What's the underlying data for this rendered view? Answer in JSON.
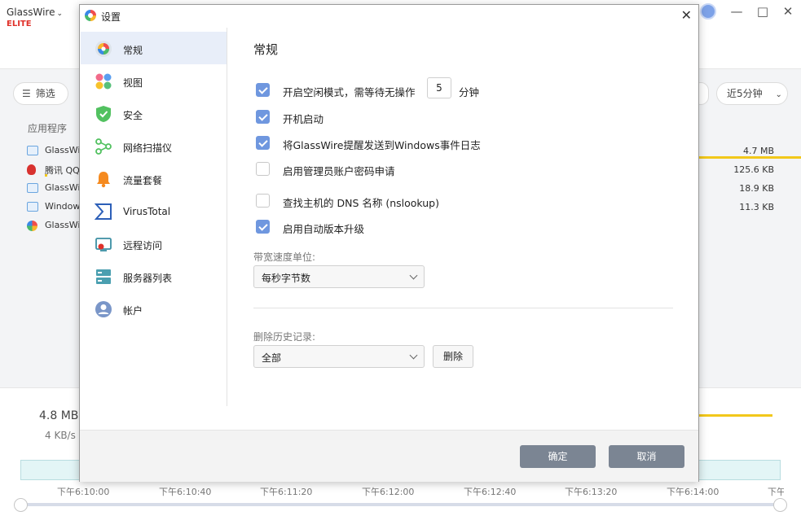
{
  "app": {
    "brand": "GlassWire",
    "edition": "ELITE",
    "filter_label": "筛选",
    "time_range_label": "近5分钟",
    "section_label": "应用程序",
    "apps": [
      {
        "name": "GlassWi",
        "size": "4.7 MB"
      },
      {
        "name": "腾讯 QQ",
        "size": "125.6 KB"
      },
      {
        "name": "GlassWi",
        "size": "18.9 KB"
      },
      {
        "name": "Windows",
        "size": "11.3 KB"
      },
      {
        "name": "GlassWi",
        "size": ""
      }
    ],
    "total_data": "4.8 MB",
    "total_rate": "4 KB/s",
    "timeline": [
      "下午6:10:00",
      "下午6:10:40",
      "下午6:11:20",
      "下午6:12:00",
      "下午6:12:40",
      "下午6:13:20",
      "下午6:14:00",
      "下午6"
    ]
  },
  "dialog": {
    "title": "设置",
    "nav": [
      {
        "label": "常规",
        "icon": "general-icon"
      },
      {
        "label": "视图",
        "icon": "view-icon"
      },
      {
        "label": "安全",
        "icon": "shield-icon"
      },
      {
        "label": "网络扫描仪",
        "icon": "network-scanner-icon"
      },
      {
        "label": "流量套餐",
        "icon": "bell-icon"
      },
      {
        "label": "VirusTotal",
        "icon": "virustotal-icon"
      },
      {
        "label": "远程访问",
        "icon": "remote-access-icon"
      },
      {
        "label": "服务器列表",
        "icon": "server-list-icon"
      },
      {
        "label": "帐户",
        "icon": "account-icon"
      }
    ],
    "section_title": "常规",
    "options": [
      {
        "label": "开启空闲模式，需等待无操作",
        "checked": true
      },
      {
        "label": "开机启动",
        "checked": true
      },
      {
        "label": "将GlassWire提醒发送到Windows事件日志",
        "checked": true
      },
      {
        "label": "启用管理员账户密码申请",
        "checked": false
      },
      {
        "label": "查找主机的 DNS 名称 (nslookup)",
        "checked": false
      },
      {
        "label": "启用自动版本升级",
        "checked": true
      }
    ],
    "idle_minutes": "5",
    "idle_unit": "分钟",
    "bandwidth_label": "带宽速度单位:",
    "bandwidth_value": "每秒字节数",
    "history_label": "删除历史记录:",
    "history_value": "全部",
    "delete_label": "删除",
    "ok_label": "确定",
    "cancel_label": "取消"
  }
}
